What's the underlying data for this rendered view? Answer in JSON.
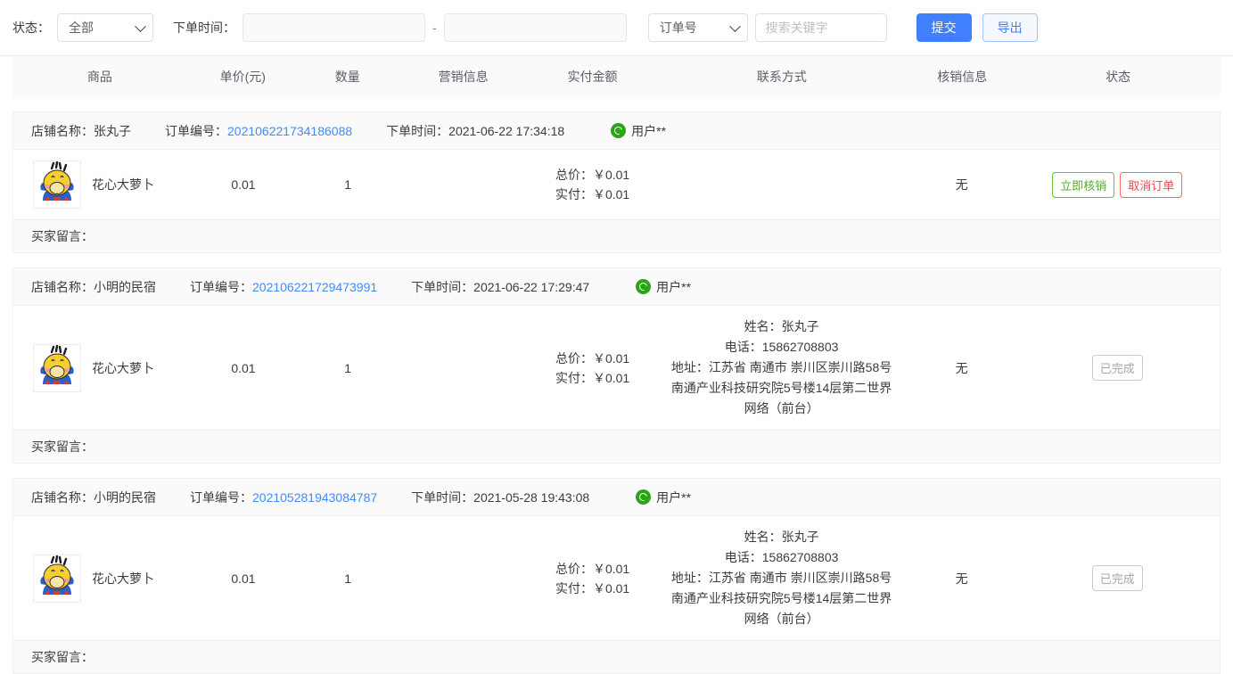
{
  "toolbar": {
    "status_label": "状态：",
    "status_value": "全部",
    "order_time_label": "下单时间：",
    "date_start_placeholder": "",
    "date_start_value": "",
    "date_end_placeholder": "",
    "date_end_value": "",
    "date_separator": "-",
    "search_field_value": "订单号",
    "keyword_placeholder": "搜索关键字",
    "keyword_value": "",
    "submit_label": "提交",
    "export_label": "导出",
    "primary_color": "#4080ff",
    "ghost_border_color": "#a5c0ff"
  },
  "table": {
    "columns": [
      {
        "key": "goods",
        "label": "商品"
      },
      {
        "key": "price",
        "label": "单价(元)"
      },
      {
        "key": "qty",
        "label": "数量"
      },
      {
        "key": "promo",
        "label": "营销信息"
      },
      {
        "key": "pay",
        "label": "实付金额"
      },
      {
        "key": "contact",
        "label": "联系方式"
      },
      {
        "key": "verify",
        "label": "核销信息"
      },
      {
        "key": "status",
        "label": "状态"
      }
    ],
    "note_label": "买家留言：",
    "labels": {
      "shop": "店铺名称：",
      "order_no": "订单编号：",
      "order_time": "下单时间：",
      "total_prefix": "总价：",
      "paid_prefix": "实付：",
      "name_prefix": "姓名：",
      "phone_prefix": "电话：",
      "address_prefix": "地址："
    },
    "orders": [
      {
        "shop": "张丸子",
        "order_no": "202106221734186088",
        "order_time": "2021-06-22 17:34:18",
        "buyer": "用户**",
        "buyer_icon": "wechat-icon",
        "goods_name": "花心大萝卜",
        "goods_icon": "duck-thumbnail",
        "unit_price": "0.01",
        "qty": "1",
        "promo": "",
        "total": "￥0.01",
        "paid": "￥0.01",
        "contact": {
          "name": "",
          "phone": "",
          "address": ""
        },
        "verify": "无",
        "actions": [
          {
            "label": "立即核销",
            "style": "green"
          },
          {
            "label": "取消订单",
            "style": "red"
          }
        ],
        "note": ""
      },
      {
        "shop": "小明的民宿",
        "order_no": "202106221729473991",
        "order_time": "2021-06-22 17:29:47",
        "buyer": "用户**",
        "buyer_icon": "wechat-icon",
        "goods_name": "花心大萝卜",
        "goods_icon": "duck-thumbnail",
        "unit_price": "0.01",
        "qty": "1",
        "promo": "",
        "total": "￥0.01",
        "paid": "￥0.01",
        "contact": {
          "name": "张丸子",
          "phone": "15862708803",
          "address": "江苏省 南通市 崇川区崇川路58号南通产业科技研究院5号楼14层第二世界网络（前台）"
        },
        "verify": "无",
        "actions": [
          {
            "label": "已完成",
            "style": "grey"
          }
        ],
        "note": ""
      },
      {
        "shop": "小明的民宿",
        "order_no": "202105281943084787",
        "order_time": "2021-05-28 19:43:08",
        "buyer": "用户**",
        "buyer_icon": "wechat-icon",
        "goods_name": "花心大萝卜",
        "goods_icon": "duck-thumbnail",
        "unit_price": "0.01",
        "qty": "1",
        "promo": "",
        "total": "￥0.01",
        "paid": "￥0.01",
        "contact": {
          "name": "张丸子",
          "phone": "15862708803",
          "address": "江苏省 南通市 崇川区崇川路58号南通产业科技研究院5号楼14层第二世界网络（前台）"
        },
        "verify": "无",
        "actions": [
          {
            "label": "已完成",
            "style": "grey"
          }
        ],
        "note": ""
      }
    ]
  }
}
